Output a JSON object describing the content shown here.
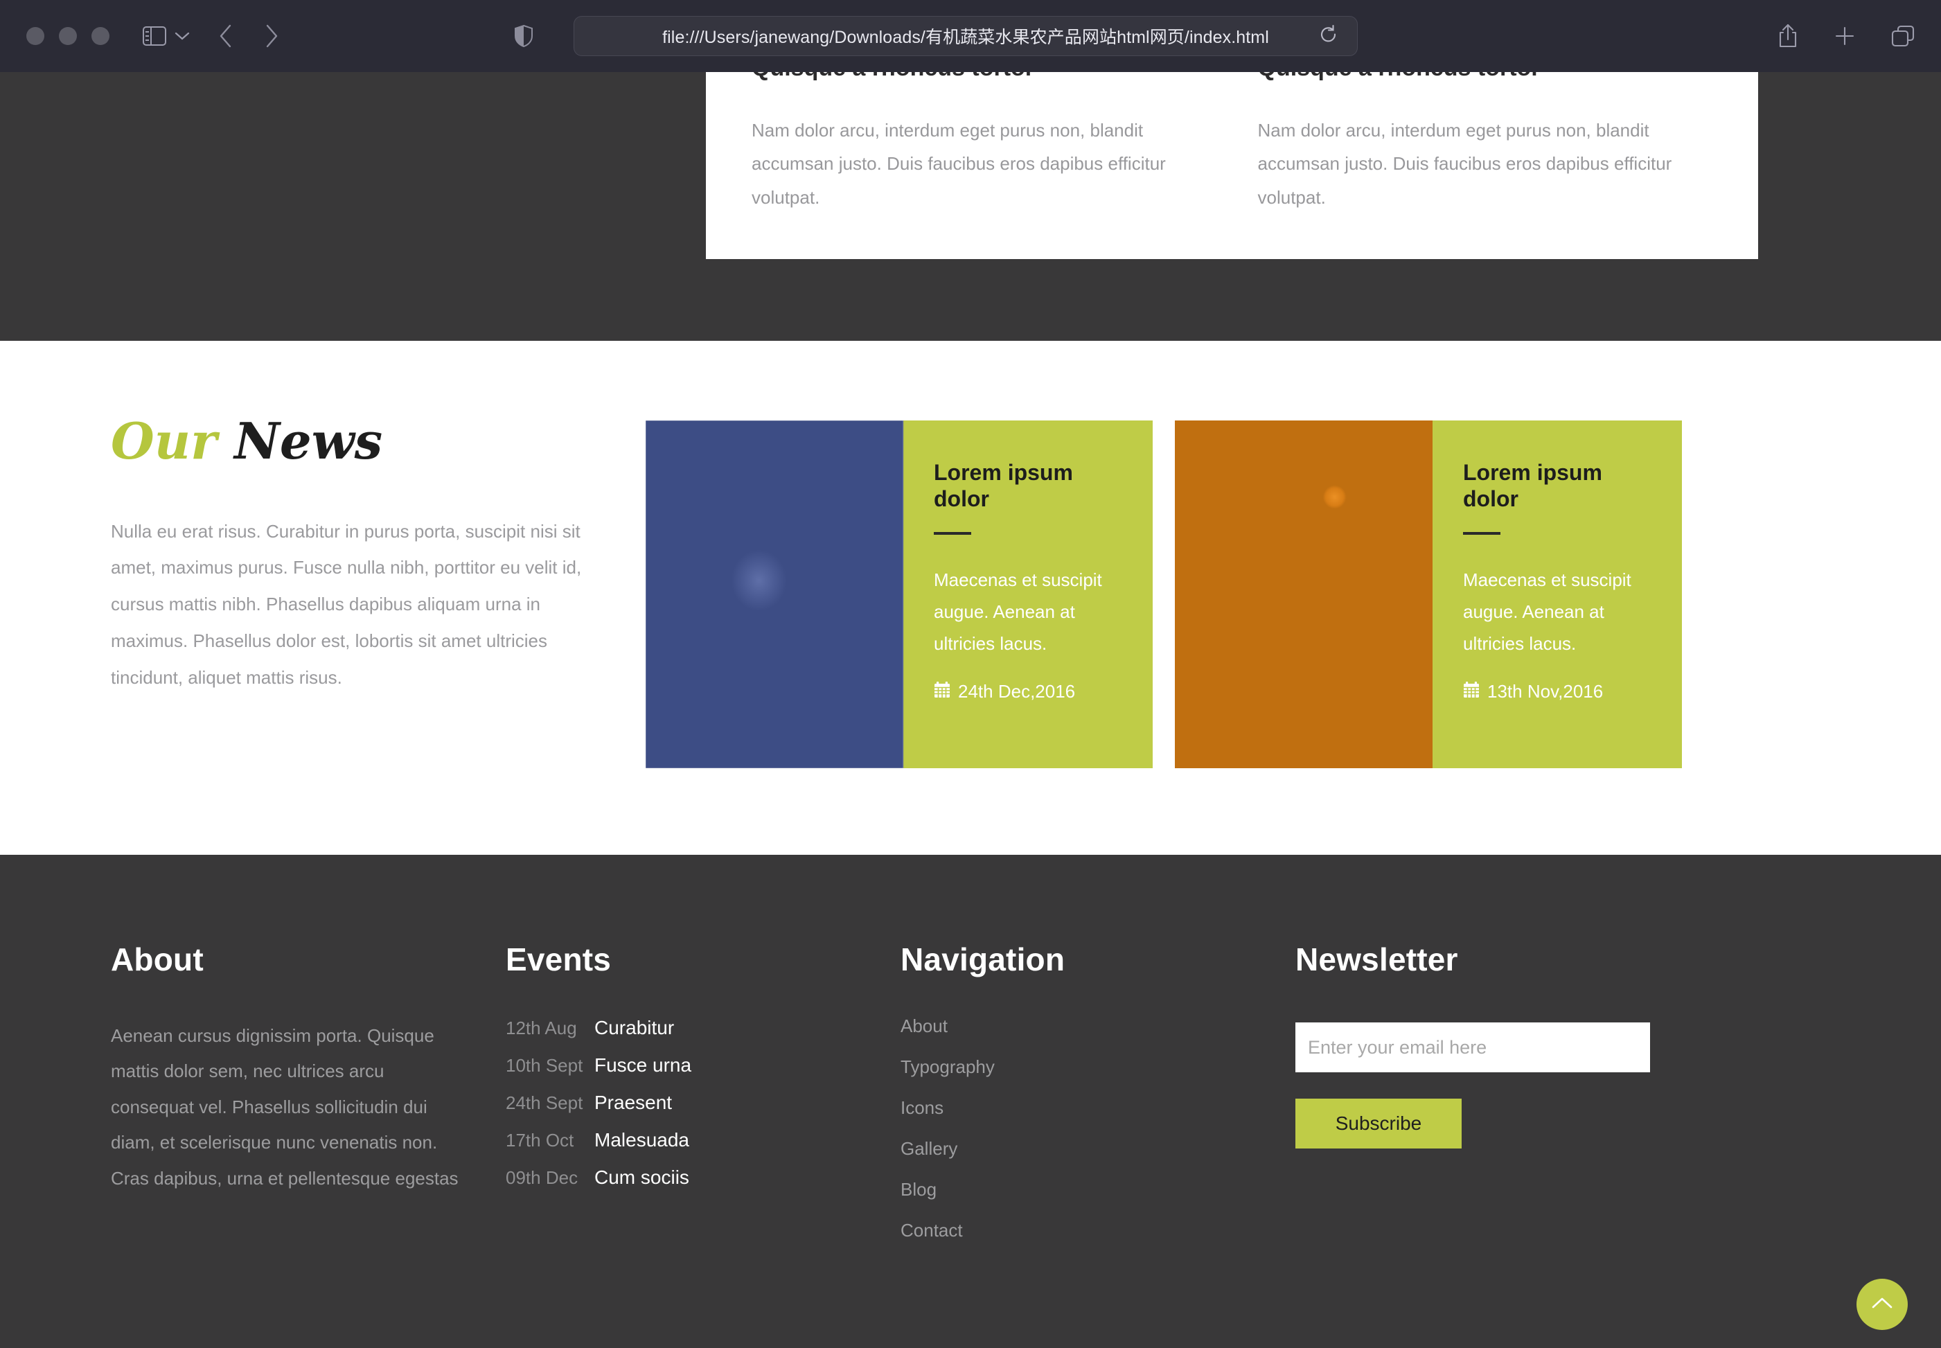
{
  "browser": {
    "url": "file:///Users/janewang/Downloads/有机蔬菜水果农产品网站html网页/index.html",
    "icons": {
      "sidebar": "sidebar-toggle-icon",
      "chevron_down": "chevron-down-icon",
      "back": "back-arrow-icon",
      "forward": "forward-arrow-icon",
      "shield": "privacy-shield-icon",
      "reload": "reload-icon",
      "share": "share-icon",
      "new_tab": "plus-icon",
      "tab_overview": "tab-overview-icon"
    }
  },
  "features": {
    "columns": [
      {
        "heading": "Quisque a rhoncus tortor",
        "body": "Nam dolor arcu, interdum eget purus non, blandit accumsan justo. Duis faucibus eros dapibus efficitur volutpat."
      },
      {
        "heading": "Quisque a rhoncus tortor",
        "body": "Nam dolor arcu, interdum eget purus non, blandit accumsan justo. Duis faucibus eros dapibus efficitur volutpat."
      }
    ]
  },
  "news": {
    "title_accent": "Our",
    "title_rest": "News",
    "description": "Nulla eu erat risus. Curabitur in purus porta, suscipit nisi sit amet, maximus purus. Fusce nulla nibh, porttitor eu velit id, cursus mattis nibh. Phasellus dapibus aliquam urna in maximus. Phasellus dolor est, lobortis sit amet ultricies tincidunt, aliquet mattis risus.",
    "cards": [
      {
        "image": "grapes-on-vine-photo",
        "title": "Lorem ipsum dolor",
        "body": "Maecenas et suscipit augue. Aenean at ultricies lacus.",
        "date": "24th Dec,2016",
        "date_icon": "calendar-icon"
      },
      {
        "image": "orange-tree-photo",
        "title": "Lorem ipsum dolor",
        "body": "Maecenas et suscipit augue. Aenean at ultricies lacus.",
        "date": "13th Nov,2016",
        "date_icon": "calendar-icon"
      }
    ]
  },
  "footer": {
    "about": {
      "heading": "About",
      "text": "Aenean cursus dignissim porta. Quisque mattis dolor sem, nec ultrices arcu consequat vel. Phasellus sollicitudin dui diam, et scelerisque nunc venenatis non. Cras dapibus, urna et pellentesque egestas"
    },
    "events": {
      "heading": "Events",
      "items": [
        {
          "date": "12th Aug",
          "name": "Curabitur"
        },
        {
          "date": "10th Sept",
          "name": "Fusce urna"
        },
        {
          "date": "24th Sept",
          "name": "Praesent"
        },
        {
          "date": "17th Oct",
          "name": "Malesuada"
        },
        {
          "date": "09th Dec",
          "name": "Cum sociis"
        }
      ]
    },
    "navigation": {
      "heading": "Navigation",
      "links": [
        "About",
        "Typography",
        "Icons",
        "Gallery",
        "Blog",
        "Contact"
      ]
    },
    "newsletter": {
      "heading": "Newsletter",
      "email_placeholder": "Enter your email here",
      "email_value": "",
      "subscribe_label": "Subscribe"
    }
  },
  "scroll_top": {
    "icon": "chevron-up-icon"
  },
  "colors": {
    "accent_green": "#BFCC47",
    "dark_bg": "#393839",
    "chrome_bg": "#2B2B36",
    "card_white": "#FFFFFF",
    "muted_text": "#9D9D9F"
  }
}
